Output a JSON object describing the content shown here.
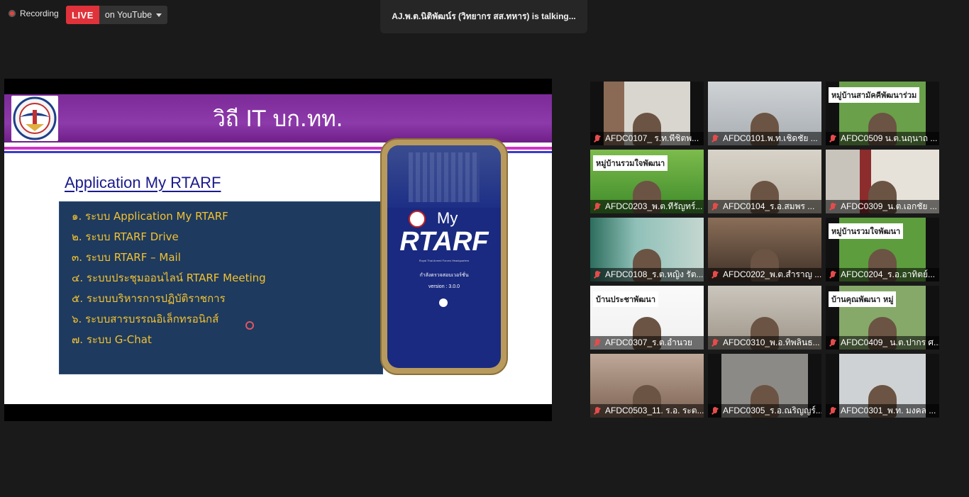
{
  "topbar": {
    "recording_label": "Recording",
    "live_label": "LIVE",
    "youtube_label": "on YouTube",
    "talking": "AJ.พ.ต.นิติพัฒน์ร (วิทยากร สส.ทหาร) is  talking..."
  },
  "slide": {
    "title": "วิถี IT บก.ทท.",
    "app_title": "Application My RTARF",
    "items": [
      "๑. ระบบ Application My RTARF",
      "๒. ระบบ RTARF Drive",
      "๓. ระบบ RTARF – Mail",
      "๔. ระบบประชุมออนไลน์ RTARF Meeting",
      "๕. ระบบบริหารการปฏิบัติราชการ",
      "๖. ระบบสารบรรณอิเล็กทรอนิกส์",
      "๗. ระบบ G-Chat"
    ],
    "phone": {
      "my": "My",
      "rtarf": "RTARF",
      "subtitle": "Royal Thai Armed Forces Headquarters",
      "checking": "กำลังตรวจสอบเวอร์ชั่น",
      "version": "version : 3.0.0"
    }
  },
  "participants": [
    {
      "name": "AFDC0107_ ร.ท.พีชิตพ...",
      "sign": ""
    },
    {
      "name": "AFDC0101.พ.ท.เชิดชัย ...",
      "sign": ""
    },
    {
      "name": "AFDC0509 น.ต.นฤนาถ ...",
      "sign": "หมู่บ้านสามัคคีพัฒนาร่วม"
    },
    {
      "name": "AFDC0203_พ.ต.ทีรัญทร์...",
      "sign": "หมู่บ้านรวมใจพัฒนา"
    },
    {
      "name": "AFDC0104_ร.อ.สมพร ...",
      "sign": ""
    },
    {
      "name": "AFDC0309_น.ต.เอกชัย ...",
      "sign": ""
    },
    {
      "name": "AFDC0108_ร.ต.หญิง รัต...",
      "sign": ""
    },
    {
      "name": "AFDC0202_พ.ต.สำราญ ...",
      "sign": ""
    },
    {
      "name": "AFDC0204_ร.อ.อาทิตย์...",
      "sign": "หมู่บ้านรวมใจพัฒนา"
    },
    {
      "name": "AFDC0307_ร.ต.อำนวย",
      "sign": "บ้านประชาพัฒนา"
    },
    {
      "name": "AFDC0310_พ.อ.ทิพลินธ...",
      "sign": ""
    },
    {
      "name": "AFDC0409_ น.ต.ปากร ศ...",
      "sign": "บ้านคุณพัฒนา หมู่"
    },
    {
      "name": "AFDC0503_11. ร.อ. ระต...",
      "sign": ""
    },
    {
      "name": "AFDC0305_ร.อ.ณริญญร์...",
      "sign": ""
    },
    {
      "name": "AFDC0301_พ.ท. มงคล ...",
      "sign": ""
    }
  ],
  "colors": {
    "live": "#e0323a",
    "banner": "#8d3aaa",
    "list_bg": "#1e3a5f",
    "list_text": "#f2c230",
    "muted_mic": "#e64b4b"
  }
}
